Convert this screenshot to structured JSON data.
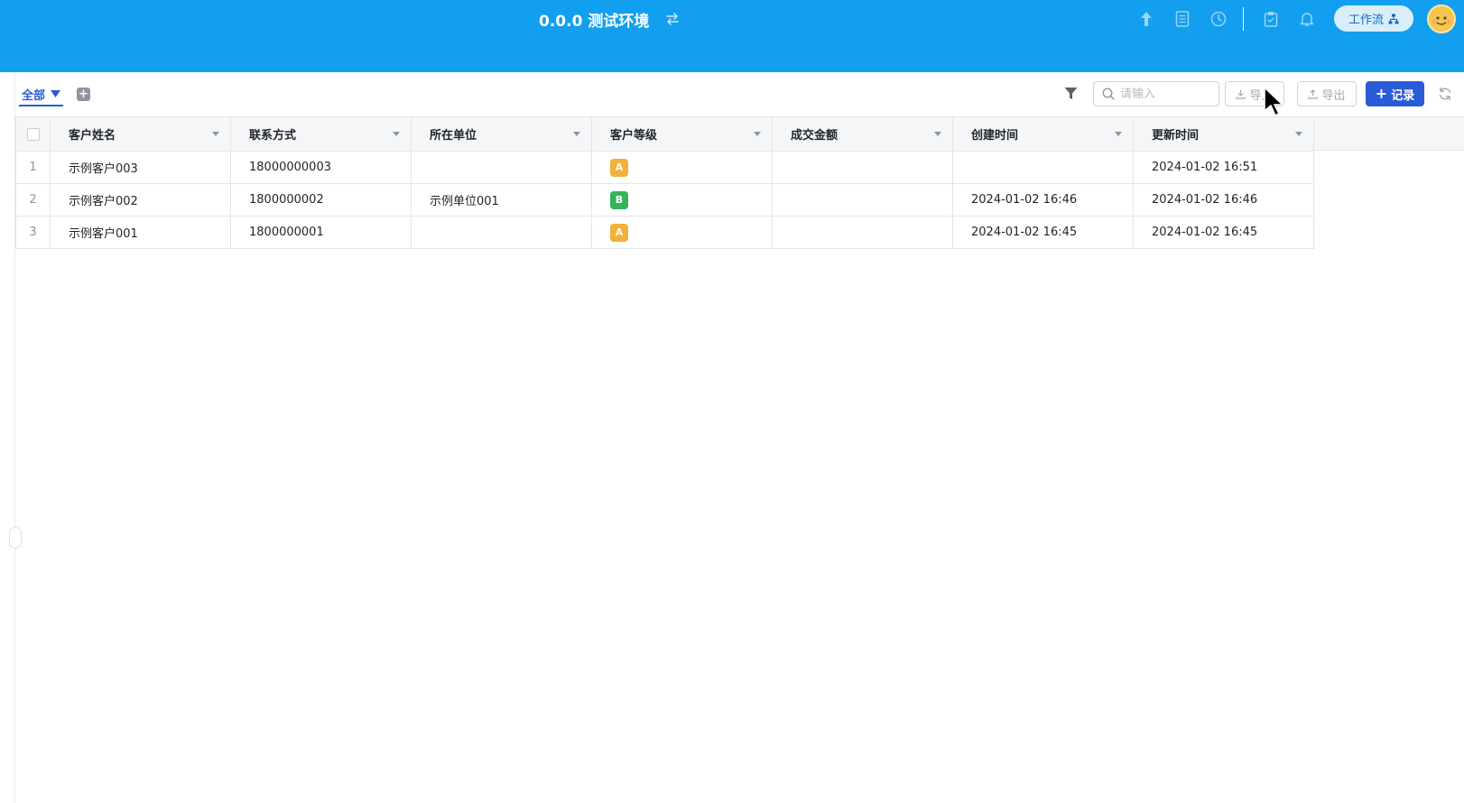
{
  "header": {
    "env_title": "0.0.0 测试环境",
    "icons": [
      "upload-arrow-icon",
      "document-icon",
      "clock-icon",
      "clipboard-icon",
      "bell-icon"
    ],
    "workflow_label": "工作流",
    "colors": {
      "bar": "#129ff0",
      "workflow_bg": "#d9eefb"
    }
  },
  "toolbar": {
    "view_label": "全部",
    "search_placeholder": "请输入",
    "import_label": "导入",
    "export_label": "导出",
    "add_record_label": "记录"
  },
  "table": {
    "columns": [
      "客户姓名",
      "联系方式",
      "所在单位",
      "客户等级",
      "成交金额",
      "创建时间",
      "更新时间"
    ],
    "rows": [
      {
        "index": "1",
        "name": "示例客户003",
        "contact": "18000000003",
        "company": "",
        "level": "A",
        "level_color": "#f0b23a",
        "amount": "",
        "created": "",
        "updated": "2024-01-02 16:51"
      },
      {
        "index": "2",
        "name": "示例客户002",
        "contact": "1800000002",
        "company": "示例单位001",
        "level": "B",
        "level_color": "#34b35a",
        "amount": "",
        "created": "2024-01-02 16:46",
        "updated": "2024-01-02 16:46"
      },
      {
        "index": "3",
        "name": "示例客户001",
        "contact": "1800000001",
        "company": "",
        "level": "A",
        "level_color": "#f0b23a",
        "amount": "",
        "created": "2024-01-02 16:45",
        "updated": "2024-01-02 16:45"
      }
    ]
  },
  "accent_color": "#2a5bd7"
}
